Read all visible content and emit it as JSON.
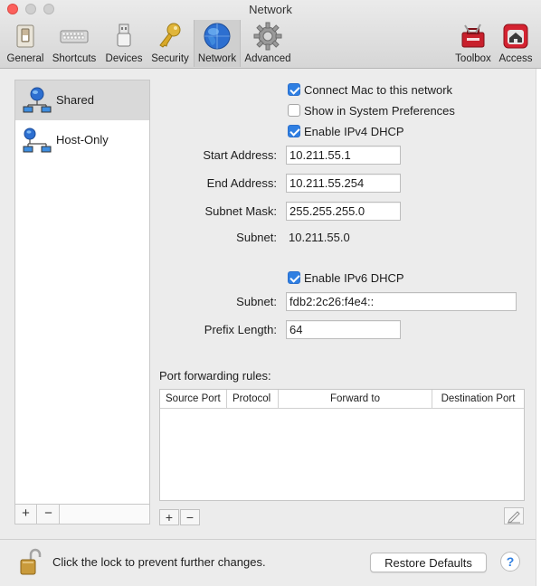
{
  "window": {
    "title": "Network"
  },
  "toolbar": {
    "items": [
      {
        "label": "General",
        "icon": "switch-icon"
      },
      {
        "label": "Shortcuts",
        "icon": "keyboard-icon"
      },
      {
        "label": "Devices",
        "icon": "usb-plug-icon"
      },
      {
        "label": "Security",
        "icon": "key-icon"
      },
      {
        "label": "Network",
        "icon": "globe-icon",
        "selected": true
      },
      {
        "label": "Advanced",
        "icon": "gear-icon"
      },
      {
        "label": "Toolbox",
        "icon": "toolbox-icon"
      },
      {
        "label": "Access",
        "icon": "access-home-icon"
      }
    ]
  },
  "sidebar": {
    "items": [
      {
        "label": "Shared",
        "selected": true
      },
      {
        "label": "Host-Only"
      }
    ],
    "add_label": "+",
    "remove_label": "−"
  },
  "settings": {
    "connect_mac": {
      "label": "Connect Mac to this network",
      "checked": true
    },
    "show_in_prefs": {
      "label": "Show in System Preferences",
      "checked": false
    },
    "ipv4_dhcp": {
      "label": "Enable IPv4 DHCP",
      "checked": true
    },
    "start_address": {
      "label": "Start Address:",
      "value": "10.211.55.1"
    },
    "end_address": {
      "label": "End Address:",
      "value": "10.211.55.254"
    },
    "subnet_mask": {
      "label": "Subnet Mask:",
      "value": "255.255.255.0"
    },
    "subnet_v4": {
      "label": "Subnet:",
      "value": "10.211.55.0"
    },
    "ipv6_dhcp": {
      "label": "Enable IPv6 DHCP",
      "checked": true
    },
    "subnet_v6": {
      "label": "Subnet:",
      "value": "fdb2:2c26:f4e4::"
    },
    "prefix_length": {
      "label": "Prefix Length:",
      "value": "64"
    }
  },
  "port_forwarding": {
    "title": "Port forwarding rules:",
    "columns": [
      "Source Port",
      "Protocol",
      "Forward to",
      "Destination Port"
    ],
    "rows": [],
    "add_label": "+",
    "remove_label": "−"
  },
  "footer": {
    "lock_text": "Click the lock to prevent further changes.",
    "restore_label": "Restore Defaults",
    "help_label": "?"
  },
  "colors": {
    "accent": "#2f7fe2",
    "close": "#fc605c"
  }
}
